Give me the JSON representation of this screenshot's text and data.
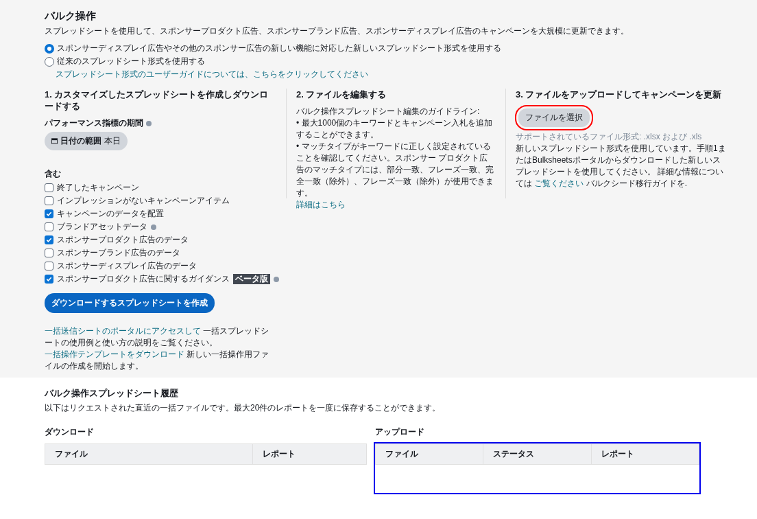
{
  "title": "バルク操作",
  "subtitle": "スプレッドシートを使用して、スポンサープロダクト広告、スポンサーブランド広告、スポンサーディスプレイ広告のキャンペーンを大規模に更新できます。",
  "format_options": [
    {
      "label": "スポンサーディスプレイ広告やその他のスポンサー広告の新しい機能に対応した新しいスプレッドシート形式を使用する",
      "selected": true
    },
    {
      "label": "従来のスプレッドシート形式を使用する",
      "selected": false
    }
  ],
  "guide_link": "スプレッドシート形式のユーザーガイドについては、こちらをクリックしてください",
  "step1": {
    "heading": "1. カスタマイズしたスプレッドシートを作成しダウンロードする",
    "period_label": "パフォーマンス指標の期間",
    "date_button": {
      "label": "日付の範囲",
      "value": "本日"
    },
    "include_label": "含む",
    "options": [
      {
        "label": "終了したキャンペーン",
        "checked": false
      },
      {
        "label": "インプレッションがないキャンペーンアイテム",
        "checked": false
      },
      {
        "label": "キャンペーンのデータを配置",
        "checked": true
      },
      {
        "label": "ブランドアセットデータ",
        "checked": false,
        "info": true
      },
      {
        "label": "スポンサープロダクト広告のデータ",
        "checked": true
      },
      {
        "label": "スポンサーブランド広告のデータ",
        "checked": false
      },
      {
        "label": "スポンサーディスプレイ広告のデータ",
        "checked": false
      },
      {
        "label": "スポンサープロダクト広告に関するガイダンス",
        "checked": true,
        "badge": "ベータ版",
        "info": true
      }
    ],
    "create_button": "ダウンロードするスプレッドシートを作成",
    "footer": [
      {
        "text": "一括送信シートのポータルにアクセスして",
        "link": true
      },
      {
        "text": " 一括スプレッドシートの使用例と使い方の説明をご覧ください。 ",
        "link": false
      },
      {
        "text": "一括操作テンプレートをダウンロード",
        "link": true
      },
      {
        "text": " 新しい一括操作用ファイルの作成を開始します。",
        "link": false
      }
    ]
  },
  "step2": {
    "heading": "2. ファイルを編集する",
    "intro": "バルク操作スプレッドシート編集のガイドライン:",
    "bullets": [
      "• 最大1000個のキーワードとキャンペーン入札を追加することができます。",
      "• マッチタイプがキーワードに正しく設定されていることを確認してください。スポンサー プロダクト広告のマッチタイプには、部分一致、フレーズ一致、完全一致（除外）、フレーズ一致（除外）が使用できます。"
    ],
    "link": "詳細はこちら"
  },
  "step3": {
    "heading": "3. ファイルをアップロードしてキャンペーンを更新",
    "file_button": {
      "label": "ファイルを選択",
      "highlighted": true
    },
    "formats": "サポートされているファイル形式: .xlsx および .xls",
    "note": [
      {
        "text": "新しいスプレッドシート形式を使用しています。手順1またはBulksheetsポータルからダウンロードした新しいスプレッドシートを使用してください。 詳細な情報については ",
        "link": false
      },
      {
        "text": "ご覧ください",
        "link": true
      },
      {
        "text": " バルクシード移行ガイドを.",
        "link": false
      }
    ]
  },
  "history": {
    "title": "バルク操作スプレッドシート履歴",
    "description": "以下はリクエストされた直近の一括ファイルです。最大20件のレポートを一度に保存することができます。",
    "download": {
      "label": "ダウンロード",
      "columns": [
        "ファイル",
        "レポート"
      ],
      "highlighted": false
    },
    "upload": {
      "label": "アップロード",
      "columns": [
        "ファイル",
        "ステータス",
        "レポート"
      ],
      "highlighted": true
    }
  }
}
